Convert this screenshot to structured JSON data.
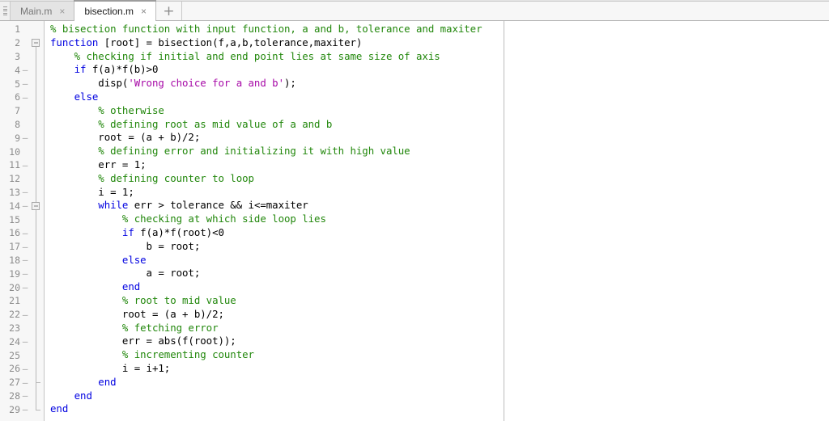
{
  "window": {
    "app": "MATLAB Editor",
    "active_file": "bisection.m"
  },
  "tabbar": {
    "grip_icon": "drag-grip-icon",
    "new_tab_label": "+",
    "close_glyph": "×",
    "tabs": [
      {
        "label": "Main.m",
        "active": false
      },
      {
        "label": "bisection.m",
        "active": true
      }
    ]
  },
  "colors": {
    "comment": "#21870b",
    "keyword": "#0000e0",
    "string": "#a709a7",
    "plain": "#000000",
    "gutter_bg": "#f7f7f7",
    "editor_bg": "#ffffff",
    "tab_active_bg": "#ffffff",
    "tab_inactive_bg": "#e4e4e4"
  },
  "editor": {
    "language": "MATLAB",
    "first_line": 1,
    "last_line": 29,
    "lines": [
      {
        "num": 1,
        "dash": false,
        "fold": "none",
        "tokens": [
          {
            "t": "comment",
            "v": "% bisection function with input function, a and b, tolerance and maxiter"
          }
        ]
      },
      {
        "num": 2,
        "dash": false,
        "fold": "box-start",
        "tokens": [
          {
            "t": "kw",
            "v": "function"
          },
          {
            "t": "plain",
            "v": " [root] = bisection(f,a,b,tolerance,maxiter)"
          }
        ]
      },
      {
        "num": 3,
        "dash": false,
        "fold": "line",
        "tokens": [
          {
            "t": "comment",
            "v": "    % checking if initial and end point lies at same size of axis"
          }
        ]
      },
      {
        "num": 4,
        "dash": true,
        "fold": "line",
        "tokens": [
          {
            "t": "plain",
            "v": "    "
          },
          {
            "t": "kw",
            "v": "if"
          },
          {
            "t": "plain",
            "v": " f(a)*f(b)>0"
          }
        ]
      },
      {
        "num": 5,
        "dash": true,
        "fold": "line",
        "tokens": [
          {
            "t": "plain",
            "v": "        disp("
          },
          {
            "t": "str",
            "v": "'Wrong choice for a and b'"
          },
          {
            "t": "plain",
            "v": ");"
          }
        ]
      },
      {
        "num": 6,
        "dash": true,
        "fold": "line",
        "tokens": [
          {
            "t": "plain",
            "v": "    "
          },
          {
            "t": "kw",
            "v": "else"
          }
        ]
      },
      {
        "num": 7,
        "dash": false,
        "fold": "line",
        "tokens": [
          {
            "t": "comment",
            "v": "        % otherwise"
          }
        ]
      },
      {
        "num": 8,
        "dash": false,
        "fold": "line",
        "tokens": [
          {
            "t": "comment",
            "v": "        % defining root as mid value of a and b"
          }
        ]
      },
      {
        "num": 9,
        "dash": true,
        "fold": "line",
        "tokens": [
          {
            "t": "plain",
            "v": "        root = (a + b)/2;"
          }
        ]
      },
      {
        "num": 10,
        "dash": false,
        "fold": "line",
        "tokens": [
          {
            "t": "comment",
            "v": "        % defining error and initializing it with high value"
          }
        ]
      },
      {
        "num": 11,
        "dash": true,
        "fold": "line",
        "tokens": [
          {
            "t": "plain",
            "v": "        err = 1;"
          }
        ]
      },
      {
        "num": 12,
        "dash": false,
        "fold": "line",
        "tokens": [
          {
            "t": "comment",
            "v": "        % defining counter to loop"
          }
        ]
      },
      {
        "num": 13,
        "dash": true,
        "fold": "line",
        "tokens": [
          {
            "t": "plain",
            "v": "        i = 1;"
          }
        ]
      },
      {
        "num": 14,
        "dash": true,
        "fold": "box-inner",
        "tokens": [
          {
            "t": "plain",
            "v": "        "
          },
          {
            "t": "kw",
            "v": "while"
          },
          {
            "t": "plain",
            "v": " err > tolerance && i<=maxiter"
          }
        ]
      },
      {
        "num": 15,
        "dash": false,
        "fold": "line",
        "tokens": [
          {
            "t": "comment",
            "v": "            % checking at which side loop lies"
          }
        ]
      },
      {
        "num": 16,
        "dash": true,
        "fold": "line",
        "tokens": [
          {
            "t": "plain",
            "v": "            "
          },
          {
            "t": "kw",
            "v": "if"
          },
          {
            "t": "plain",
            "v": " f(a)*f(root)<0"
          }
        ]
      },
      {
        "num": 17,
        "dash": true,
        "fold": "line",
        "tokens": [
          {
            "t": "plain",
            "v": "                b = root;"
          }
        ]
      },
      {
        "num": 18,
        "dash": true,
        "fold": "line",
        "tokens": [
          {
            "t": "plain",
            "v": "            "
          },
          {
            "t": "kw",
            "v": "else"
          }
        ]
      },
      {
        "num": 19,
        "dash": true,
        "fold": "line",
        "tokens": [
          {
            "t": "plain",
            "v": "                a = root;"
          }
        ]
      },
      {
        "num": 20,
        "dash": true,
        "fold": "line",
        "tokens": [
          {
            "t": "plain",
            "v": "            "
          },
          {
            "t": "kw",
            "v": "end"
          }
        ]
      },
      {
        "num": 21,
        "dash": false,
        "fold": "line",
        "tokens": [
          {
            "t": "comment",
            "v": "            % root to mid value"
          }
        ]
      },
      {
        "num": 22,
        "dash": true,
        "fold": "line",
        "tokens": [
          {
            "t": "plain",
            "v": "            root = (a + b)/2;"
          }
        ]
      },
      {
        "num": 23,
        "dash": false,
        "fold": "line",
        "tokens": [
          {
            "t": "comment",
            "v": "            % fetching error"
          }
        ]
      },
      {
        "num": 24,
        "dash": true,
        "fold": "line",
        "tokens": [
          {
            "t": "plain",
            "v": "            err = abs(f(root));"
          }
        ]
      },
      {
        "num": 25,
        "dash": false,
        "fold": "line",
        "tokens": [
          {
            "t": "comment",
            "v": "            % incrementing counter"
          }
        ]
      },
      {
        "num": 26,
        "dash": true,
        "fold": "line",
        "tokens": [
          {
            "t": "plain",
            "v": "            i = i+1;"
          }
        ]
      },
      {
        "num": 27,
        "dash": true,
        "fold": "tick",
        "tokens": [
          {
            "t": "plain",
            "v": "        "
          },
          {
            "t": "kw",
            "v": "end"
          }
        ]
      },
      {
        "num": 28,
        "dash": true,
        "fold": "line",
        "tokens": [
          {
            "t": "plain",
            "v": "    "
          },
          {
            "t": "kw",
            "v": "end"
          }
        ]
      },
      {
        "num": 29,
        "dash": true,
        "fold": "end",
        "tokens": [
          {
            "t": "kw",
            "v": "end"
          }
        ]
      }
    ]
  }
}
